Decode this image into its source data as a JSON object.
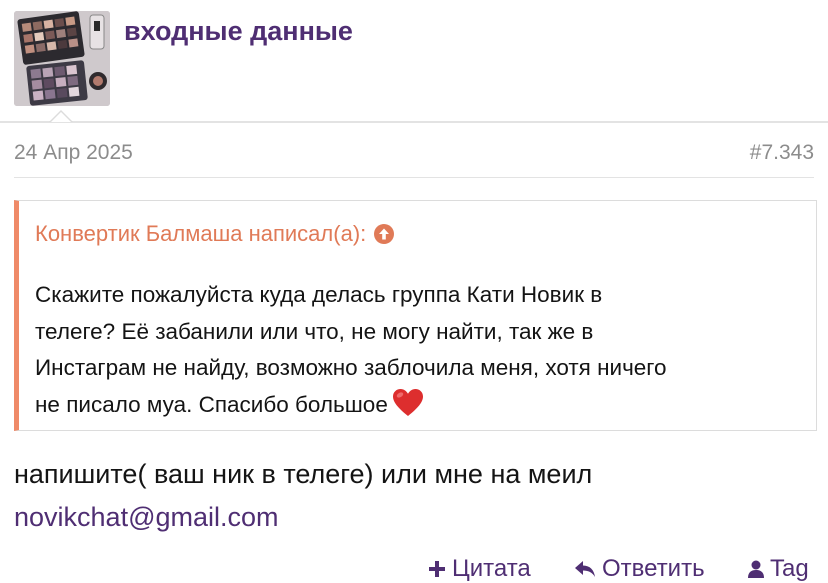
{
  "post": {
    "author": "входные данные",
    "date": "24 Апр 2025",
    "number": "#7.343"
  },
  "quote": {
    "header": "Конвертик Балмаша написал(а):",
    "lines": [
      "Скажите пожалуйста куда делась группа Кати Новик в",
      "телеге? Её забанили или что, не могу найти, так же в",
      "Инстаграм не найду, возможно заблочила меня, хотя ничего",
      "не писало муа. Спасибо большое"
    ]
  },
  "reply": {
    "text": "напишите( ваш ник в телеге) или мне на меил",
    "email": "novikchat@gmail.com"
  },
  "actions": {
    "quote_label": "Цитата",
    "answer_label": "Ответить",
    "tag_label": "Tag"
  },
  "colors": {
    "accent": "#4f2e73",
    "quote_border": "#ef8a68",
    "quote_header": "#e07a57",
    "meta": "#8c8c8c"
  }
}
